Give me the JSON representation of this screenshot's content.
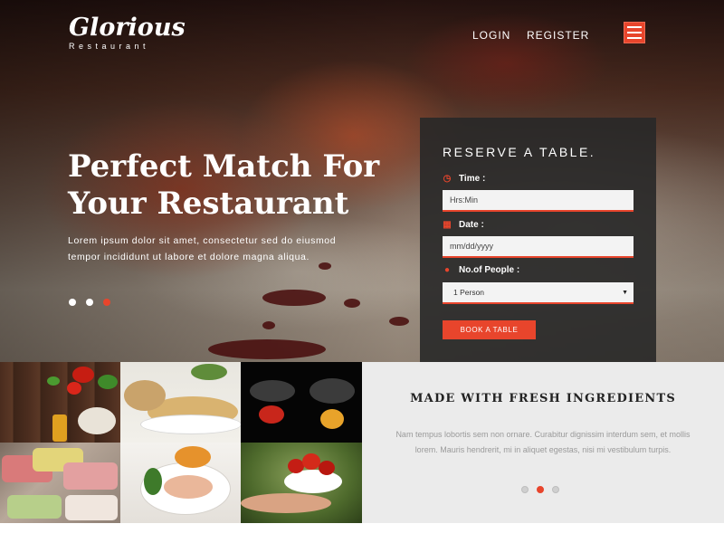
{
  "brand": {
    "name": "Glorious",
    "tagline": "Restaurant"
  },
  "nav": {
    "login": "LOGIN",
    "register": "REGISTER",
    "menu_icon": "hamburger-menu-icon"
  },
  "hero": {
    "title_line1": "Perfect Match For",
    "title_line2": "Your Restaurant",
    "text_line1": "Lorem ipsum dolor sit amet, consectetur sed do eiusmod",
    "text_line2": "tempor incididunt ut labore et dolore magna aliqua.",
    "slides": 3,
    "active_slide": 3
  },
  "reservation": {
    "title": "RESERVE A TABLE.",
    "time": {
      "label": "Time :",
      "placeholder": "Hrs:Min",
      "icon": "clock-icon"
    },
    "date": {
      "label": "Date :",
      "placeholder": "mm/dd/yyyy",
      "icon": "calendar-icon"
    },
    "people": {
      "label": "No.of People :",
      "selected": "1 Person",
      "icon": "users-icon"
    },
    "button": "BOOK A TABLE"
  },
  "fresh": {
    "title": "MADE WITH FRESH INGREDIENTS",
    "text_line1": "Nam tempus lobortis sem non ornare. Curabitur dignissim interdum sem, et mollis",
    "text_line2": "lorem. Mauris hendrerit, mi in aliquet egestas, nisi mi vestibulum turpis.",
    "slides": 3,
    "active_slide": 2
  },
  "colors": {
    "accent": "#e8452c",
    "panel": "#282828",
    "section_bg": "#ebebeb"
  }
}
